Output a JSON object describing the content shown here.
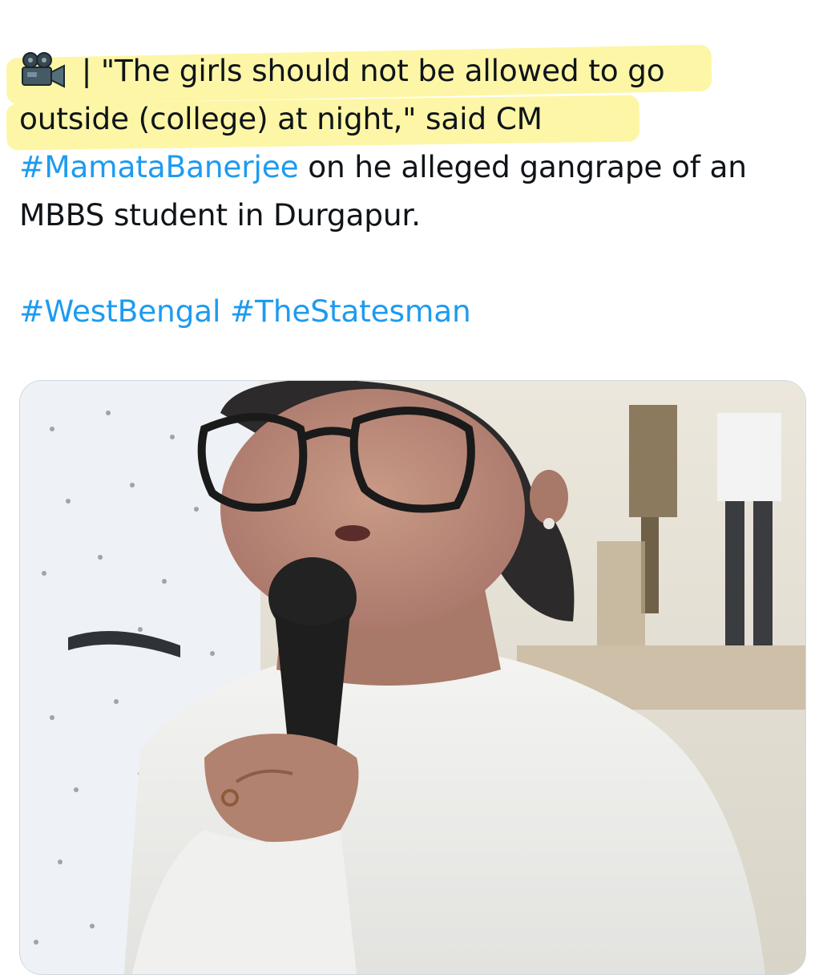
{
  "tweet": {
    "camera_icon": "movie-camera-icon",
    "line1_text": " | \"The girls should not be allowed to go",
    "line2_text": "outside (college) at night,\" said CM",
    "line3_hashtag": "#MamataBanerjee",
    "line3_text": " on he alleged gangrape of an",
    "line4_text": "MBBS student in Durgapur.",
    "hashtags": [
      "#WestBengal",
      "#TheStatesman"
    ],
    "highlight_color": "#fdf6a6",
    "link_color": "#1d9bf0",
    "text_color": "#0f1419"
  },
  "media": {
    "type": "video-still",
    "subject": "woman-speaking-into-microphone"
  }
}
